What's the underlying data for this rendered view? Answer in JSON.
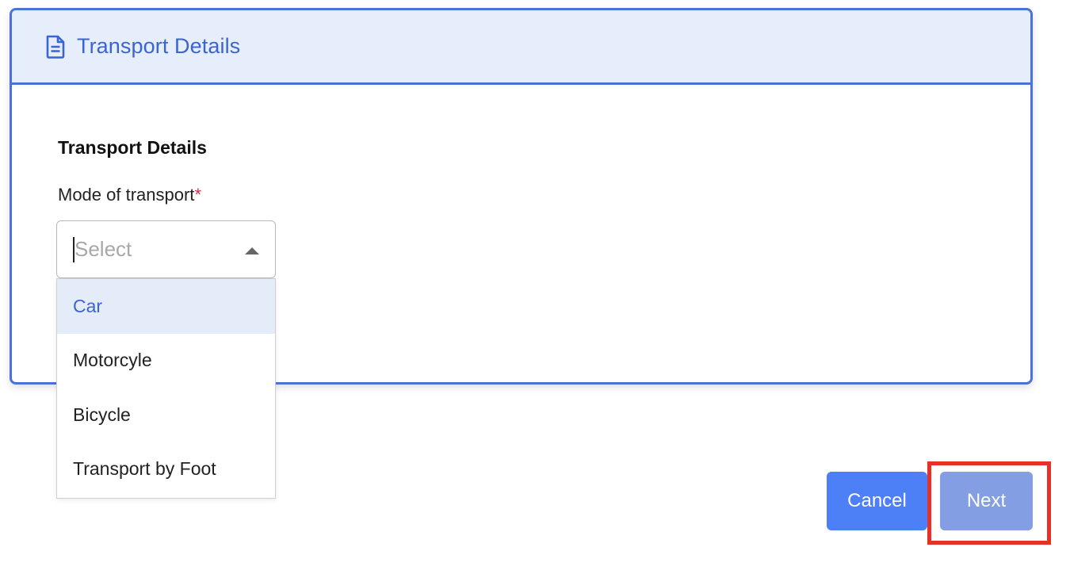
{
  "card": {
    "header_title": "Transport Details",
    "header_icon": "document-icon"
  },
  "form": {
    "section_title": "Transport Details",
    "field_label": "Mode of transport",
    "required_marker": "*",
    "select": {
      "placeholder": "Select",
      "expanded": true,
      "options": [
        "Car",
        "Motorcyle",
        "Bicycle",
        "Transport by Foot"
      ],
      "highlighted_option": "Car"
    }
  },
  "actions": {
    "cancel_label": "Cancel",
    "next_label": "Next"
  },
  "colors": {
    "accent": "#4a72d9",
    "header_bg": "#e7eefb",
    "cancel_button": "#4d7ff7",
    "next_button": "#839ee2",
    "highlight_box": "#e53127",
    "required": "#d03050"
  }
}
